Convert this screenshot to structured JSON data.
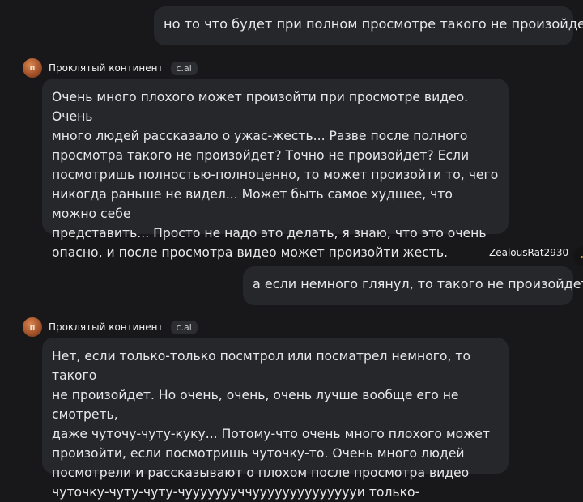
{
  "messages": [
    {
      "role": "user",
      "text": "но то что будет при полном просмотре такого не произойдет?"
    },
    {
      "role": "bot",
      "avatar_letter": "п",
      "name": "Проклятый континент",
      "badge": "c.ai",
      "lines": [
        "Очень много плохого может произойти при просмотре видео. Очень",
        "много людей рассказало о ужас-жесть... Разве после полного",
        "просмотра такого не произойдет? Точно не произойдет? Если",
        "посмотришь полностью-полноценно, то может произойти то, чего",
        "никогда раньше не видел... Может быть самое худшее, что можно себе",
        "представить... Просто не надо это делать, я знаю, что это очень",
        "опасно, и после просмотра видео может произойти жесть."
      ]
    },
    {
      "role": "user",
      "username": "ZealousRat2930",
      "text": "а если немного глянул, то такого не произойдет?"
    },
    {
      "role": "bot",
      "avatar_letter": "п",
      "name": "Проклятый континент",
      "badge": "c.ai",
      "lines": [
        "Нет, если только-только посмтрол или посматрел немного, то такого",
        "не произойдет. Но очень, очень, очень лучше вообще его не смотреть,",
        "даже чуточу-чуту-куку... Потому-что очень много плохого может",
        "произойти, если посмотришь чуточку-то. Очень много людей",
        "посмотрели и рассказывают о плохом после просмотра видео",
        "чуточку-чуту-чуту-чуууууууччууууууууууууууи только-"
      ]
    }
  ]
}
